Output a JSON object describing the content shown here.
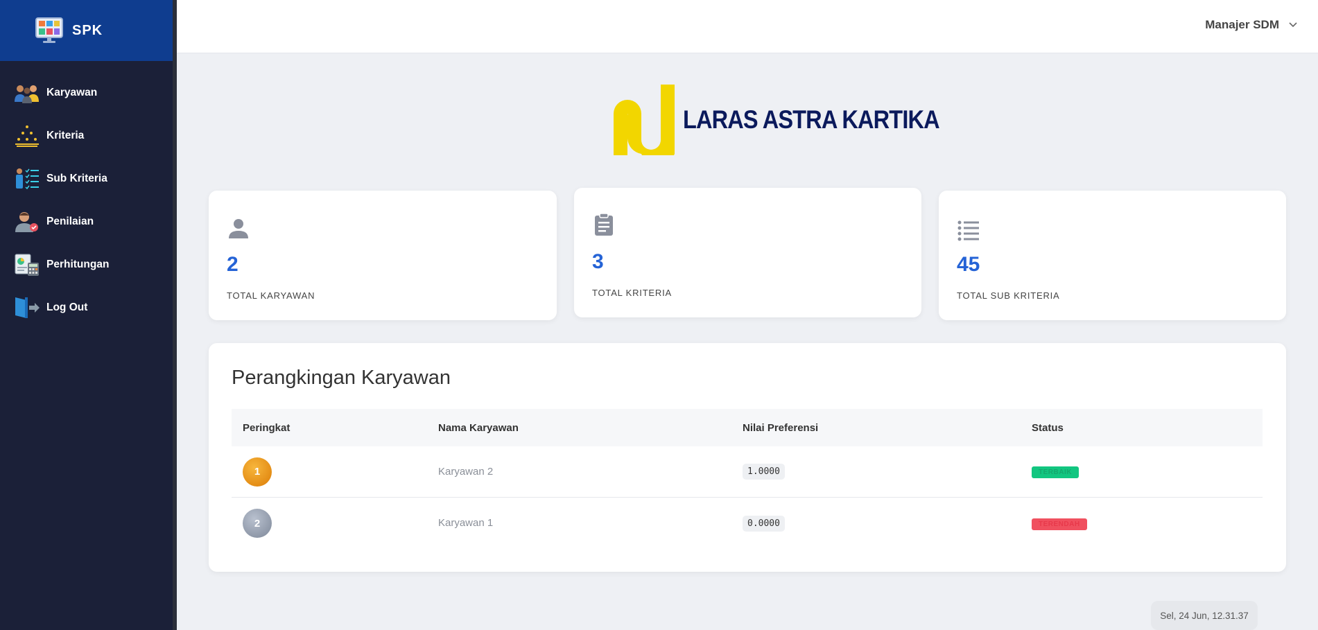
{
  "sidebar": {
    "brand": "SPK",
    "items": [
      {
        "label": "Karyawan",
        "icon": "employees-icon"
      },
      {
        "label": "Kriteria",
        "icon": "criteria-icon"
      },
      {
        "label": "Sub Kriteria",
        "icon": "sub-criteria-icon"
      },
      {
        "label": "Penilaian",
        "icon": "assessment-icon"
      },
      {
        "label": "Perhitungan",
        "icon": "calculation-icon"
      },
      {
        "label": "Log Out",
        "icon": "logout-icon"
      }
    ]
  },
  "header": {
    "user": "Manajer SDM"
  },
  "company": {
    "name": "LARAS ASTRA KARTIKA"
  },
  "stats": [
    {
      "value": "2",
      "label": "TOTAL KARYAWAN",
      "icon": "person-icon"
    },
    {
      "value": "3",
      "label": "TOTAL KRITERIA",
      "icon": "clipboard-icon"
    },
    {
      "value": "45",
      "label": "TOTAL SUB KRITERIA",
      "icon": "list-icon"
    }
  ],
  "ranking": {
    "title": "Perangkingan Karyawan",
    "columns": [
      "Peringkat",
      "Nama Karyawan",
      "Nilai Preferensi",
      "Status"
    ],
    "rows": [
      {
        "rank": "1",
        "name": "Karyawan 2",
        "preference": "1.0000",
        "status": "TERBAIK"
      },
      {
        "rank": "2",
        "name": "Karyawan 1",
        "preference": "0.0000",
        "status": "TERENDAH"
      }
    ]
  },
  "footer": {
    "datetime": "Sel, 24 Jun, 12.31.37"
  },
  "colors": {
    "sidebar": "#1b2038",
    "brand_bar": "#0f3d8f",
    "accent": "#2563d6",
    "status_best": "#12c680",
    "status_lowest": "#f0505f"
  }
}
